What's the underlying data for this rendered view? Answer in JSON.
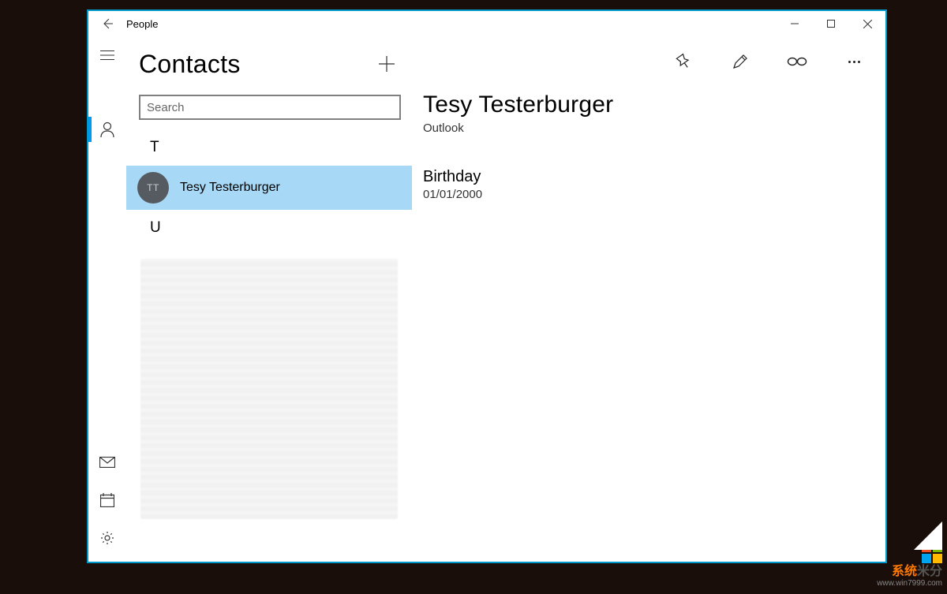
{
  "app_title": "People",
  "left": {
    "heading": "Contacts",
    "search_placeholder": "Search",
    "groups": [
      {
        "letter": "T",
        "contacts": [
          {
            "initials": "TT",
            "name": "Tesy Testerburger",
            "selected": true
          }
        ]
      },
      {
        "letter": "U",
        "contacts": []
      }
    ]
  },
  "detail": {
    "name": "Tesy Testerburger",
    "source": "Outlook",
    "fields": [
      {
        "label": "Birthday",
        "value": "01/01/2000"
      }
    ]
  },
  "toolbar": {
    "pin": "Pin",
    "edit": "Edit",
    "link": "Link",
    "more": "More"
  },
  "watermark": {
    "brand_a": "系统",
    "brand_b": "米分",
    "url": "www.win7999.com"
  }
}
